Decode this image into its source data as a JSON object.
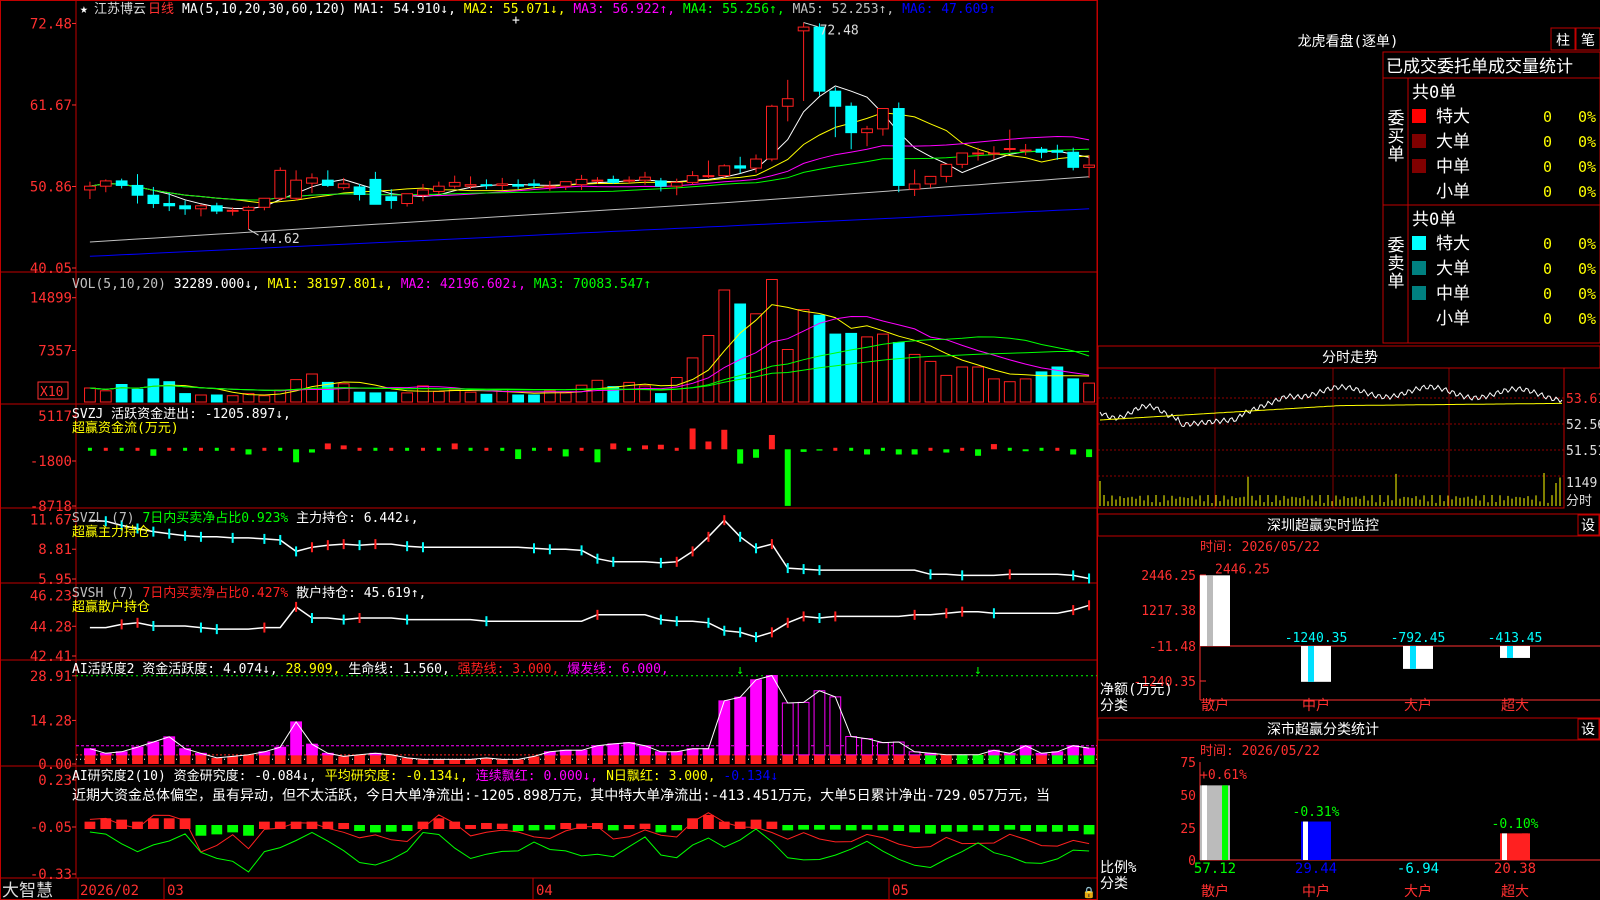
{
  "stock": {
    "name": "江苏博云",
    "period": "日线"
  },
  "colors": {
    "up": "#ff2020",
    "down": "#00ffff",
    "frame": "#c00000",
    "ma1": "#ffffff",
    "ma2": "#ffff00",
    "ma3": "#ff00ff",
    "ma4": "#00ff00",
    "ma5": "#c0c0c0",
    "ma6": "#0000ff"
  },
  "main_legend": [
    {
      "text": "MA(5,10,20,30,60,120)",
      "color": "#ffffff"
    },
    {
      "text": "MA1: 54.910↓,",
      "color": "#ffffff"
    },
    {
      "text": "MA2: 55.071↓,",
      "color": "#ffff00"
    },
    {
      "text": "MA3: 56.922↑,",
      "color": "#ff00ff"
    },
    {
      "text": "MA4: 55.256↑,",
      "color": "#00ff00"
    },
    {
      "text": "MA5: 52.253↑,",
      "color": "#c0c0c0"
    },
    {
      "text": "MA6: 47.609↑",
      "color": "#0000ff"
    }
  ],
  "main_axis": [
    "72.48",
    "61.67",
    "50.86",
    "40.05"
  ],
  "main_annotations": {
    "high": "72.48",
    "low": "44.62"
  },
  "vol_legend": [
    {
      "text": "VOL(5,10,20)",
      "color": "#c0c0c0"
    },
    {
      "text": "32289.000↓,",
      "color": "#ffffff"
    },
    {
      "text": "MA1: 38197.801↓,",
      "color": "#ffff00"
    },
    {
      "text": "MA2: 42196.602↓,",
      "color": "#ff00ff"
    },
    {
      "text": "MA3: 70083.547↑",
      "color": "#00ff00"
    }
  ],
  "vol_axis": [
    "14899",
    "7357"
  ],
  "vol_unit": "X10",
  "svzj_legend": [
    {
      "text": "SVZJ  活跃资金进出: -1205.897↓,",
      "color": "#ffffff"
    }
  ],
  "svzj_sub": "超赢资金流(万元)",
  "svzj_axis": [
    "5117",
    "-1800",
    "-8718"
  ],
  "svzl_legend": [
    {
      "text": "SVZL (7)",
      "color": "#c0c0c0"
    },
    {
      "text": "7日内买卖净占比0.923%",
      "color": "#00ff00"
    },
    {
      "text": "主力持仓: 6.442↓,",
      "color": "#ffffff"
    }
  ],
  "svzl_sub": "超赢主力持仓",
  "svzl_axis": [
    "11.67",
    "8.81",
    "5.95"
  ],
  "svsh_legend": [
    {
      "text": "SVSH (7)",
      "color": "#c0c0c0"
    },
    {
      "text": "7日内买卖净占比0.427%",
      "color": "#ff2020"
    },
    {
      "text": "散户持仓: 45.619↑,",
      "color": "#ffffff"
    }
  ],
  "svsh_sub": "超赢散户持仓",
  "svsh_axis": [
    "46.23",
    "44.28",
    "42.41"
  ],
  "ai1_legend": [
    {
      "text": "AI活跃度2 资金活跃度: 4.074↓,",
      "color": "#ffffff"
    },
    {
      "text": "28.909,",
      "color": "#ffff00"
    },
    {
      "text": "生命线: 1.560,",
      "color": "#ffffff"
    },
    {
      "text": "强势线: 3.000,",
      "color": "#ff2020"
    },
    {
      "text": "爆发线: 6.000,",
      "color": "#ff00ff"
    }
  ],
  "ai1_axis": [
    "28.91",
    "14.28",
    "0.00"
  ],
  "ai2_legend": [
    {
      "text": "AI研究度2(10) 资金研究度: -0.084↓,",
      "color": "#ffffff"
    },
    {
      "text": "平均研究度: -0.134↓,",
      "color": "#ffff00"
    },
    {
      "text": "连续飘红: 0.000↓,",
      "color": "#ff00ff"
    },
    {
      "text": "N日飘红: 3.000,",
      "color": "#ffff00"
    },
    {
      "text": "-0.134↓",
      "color": "#0000ff"
    }
  ],
  "ai2_text": "近期大资金总体偏空，虽有异动，但不太活跃，今日大单净流出:-1205.898万元，其中特大单净流出:-413.451万元，大单5日累计净出-729.057万元，当",
  "ai2_axis": [
    "0.23",
    "-0.05",
    "-0.33"
  ],
  "bottom_bar": {
    "brand": "大智慧",
    "date": "2026/02",
    "months": [
      "03",
      "04",
      "05"
    ]
  },
  "lhb": {
    "title": "龙虎看盘(逐单)",
    "btn1": "柱",
    "btn2": "笔",
    "header": "已成交委托单成交量统计",
    "buy_label": "委买单",
    "sell_label": "委卖单",
    "buy_total": "共0单",
    "sell_total": "共0单",
    "buy_rows": [
      {
        "name": "特大",
        "count": "0",
        "pct": "0%",
        "color": "#ff0000"
      },
      {
        "name": "大单",
        "count": "0",
        "pct": "0%",
        "color": "#800000"
      },
      {
        "name": "中单",
        "count": "0",
        "pct": "0%",
        "color": "#800000"
      },
      {
        "name": "小单",
        "count": "0",
        "pct": "0%",
        "color": "#000000"
      }
    ],
    "sell_rows": [
      {
        "name": "特大",
        "count": "0",
        "pct": "0%",
        "color": "#00ffff"
      },
      {
        "name": "大单",
        "count": "0",
        "pct": "0%",
        "color": "#008080"
      },
      {
        "name": "中单",
        "count": "0",
        "pct": "0%",
        "color": "#008080"
      },
      {
        "name": "小单",
        "count": "0",
        "pct": "0%",
        "color": "#000000"
      }
    ]
  },
  "intraday": {
    "title": "分时走势",
    "axis": [
      "53.61",
      "52.56",
      "51.51"
    ],
    "vol_axis": "1149",
    "unit": "分时"
  },
  "sz_monitor": {
    "title": "深圳超赢实时监控",
    "btn": "设",
    "time": "时间: 2026/05/22",
    "axis": [
      "2446.25",
      "1217.38",
      "-11.48",
      "-1240.35"
    ],
    "ylabel": "净额(万元)",
    "xlabel": "分类",
    "categories": [
      "散户",
      "中户",
      "大户",
      "超大"
    ],
    "bar_labels": [
      "2446.25",
      "-1240.35",
      "-792.45",
      "-413.45"
    ]
  },
  "sz_class": {
    "title": "深市超赢分类统计",
    "btn": "设",
    "time": "时间: 2026/05/22",
    "axis": [
      "75",
      "50",
      "25",
      "0"
    ],
    "ylabel": "比例%",
    "xlabel": "分类",
    "categories": [
      "散户",
      "中户",
      "大户",
      "超大"
    ],
    "top_labels": [
      "+0.61%",
      "-0.31%",
      "",
      "-0.10%"
    ],
    "bottom_labels": [
      "57.12",
      "29.44",
      "-6.94",
      "20.38"
    ]
  },
  "chart_data": [
    {
      "type": "candlestick",
      "title": "江苏博云 日线",
      "x": [
        "2026-02-26",
        "2026-02-27",
        "2026-03-02",
        "2026-03-03",
        "2026-03-04",
        "2026-03-05",
        "2026-03-06",
        "2026-03-09",
        "2026-03-10",
        "2026-03-11",
        "2026-03-12",
        "2026-03-13",
        "2026-03-16",
        "2026-03-17",
        "2026-03-18",
        "2026-03-19",
        "2026-03-20",
        "2026-03-23",
        "2026-03-24",
        "2026-03-25",
        "2026-03-26",
        "2026-03-27",
        "2026-03-30",
        "2026-03-31",
        "2026-04-01",
        "2026-04-02",
        "2026-04-03",
        "2026-04-07",
        "2026-04-08",
        "2026-04-09",
        "2026-04-10",
        "2026-04-13",
        "2026-04-14",
        "2026-04-15",
        "2026-04-16",
        "2026-04-17",
        "2026-04-20",
        "2026-04-21",
        "2026-04-22",
        "2026-04-23",
        "2026-04-24",
        "2026-04-27",
        "2026-04-28",
        "2026-04-29",
        "2026-04-30",
        "2026-05-06",
        "2026-05-07",
        "2026-05-08",
        "2026-05-11",
        "2026-05-12",
        "2026-05-13",
        "2026-05-14",
        "2026-05-15",
        "2026-05-18",
        "2026-05-19",
        "2026-05-20",
        "2026-05-21",
        "2026-05-22",
        "2026-05-25",
        "2026-05-26",
        "2026-05-27",
        "2026-05-28",
        "2026-05-29",
        "2026-06-01"
      ],
      "open": [
        50.4,
        50.9,
        51.6,
        51.0,
        49.7,
        48.6,
        48.3,
        47.9,
        48.3,
        47.6,
        47.7,
        48.1,
        49.3,
        49.3,
        51.3,
        51.7,
        50.7,
        50.8,
        51.8,
        49.5,
        48.6,
        49.7,
        50.2,
        50.9,
        50.9,
        51.1,
        51.0,
        51.1,
        51.2,
        50.9,
        50.9,
        51.1,
        51.7,
        51.8,
        51.7,
        51.7,
        51.6,
        50.9,
        51.4,
        52.3,
        52.3,
        53.6,
        53.3,
        54.5,
        61.5,
        71.5,
        72.0,
        63.5,
        61.5,
        58.0,
        58.5,
        61.2,
        50.5,
        51.2,
        52.2,
        53.8,
        55.3,
        55.3,
        55.9,
        55.7,
        55.8,
        55.6,
        55.4,
        53.4
      ],
      "high": [
        51.5,
        51.8,
        51.9,
        52.5,
        50.8,
        50.0,
        49.0,
        48.5,
        48.7,
        48.1,
        48.3,
        49.2,
        53.4,
        53.0,
        52.6,
        53.0,
        52.0,
        51.2,
        52.8,
        50.5,
        49.9,
        51.2,
        51.5,
        52.3,
        52.2,
        51.8,
        52.0,
        51.8,
        51.8,
        51.6,
        51.5,
        52.4,
        52.1,
        52.3,
        52.2,
        52.8,
        52.0,
        51.9,
        52.9,
        54.3,
        53.8,
        54.8,
        55.1,
        61.7,
        65.0,
        72.6,
        72.5,
        64.0,
        62.0,
        58.9,
        59.5,
        62.0,
        53.1,
        51.8,
        53.3,
        55.0,
        56.0,
        56.2,
        58.4,
        56.5,
        56.1,
        56.4,
        56.0,
        55.0
      ],
      "low": [
        49.2,
        50.1,
        50.6,
        48.6,
        48.0,
        47.6,
        47.1,
        46.9,
        47.2,
        47.0,
        45.2,
        47.7,
        49.0,
        49.0,
        50.0,
        50.8,
        50.4,
        49.0,
        49.3,
        47.9,
        48.2,
        48.9,
        49.8,
        50.6,
        50.5,
        50.5,
        50.4,
        50.5,
        50.6,
        50.3,
        50.4,
        50.4,
        51.2,
        51.2,
        51.2,
        51.1,
        50.2,
        49.7,
        51.1,
        52.0,
        52.0,
        52.6,
        52.7,
        54.2,
        59.5,
        62.2,
        62.9,
        57.4,
        55.8,
        56.2,
        57.6,
        50.1,
        49.6,
        50.7,
        51.4,
        53.3,
        54.3,
        54.5,
        55.4,
        55.0,
        54.6,
        54.4,
        53.0,
        52.0
      ],
      "close": [
        50.9,
        51.6,
        51.0,
        49.7,
        48.6,
        48.3,
        47.9,
        48.3,
        47.6,
        47.7,
        48.1,
        49.3,
        53.0,
        51.7,
        52.0,
        51.0,
        51.2,
        49.8,
        48.5,
        49.0,
        49.9,
        50.4,
        50.9,
        51.4,
        51.1,
        51.0,
        51.2,
        50.9,
        51.0,
        50.9,
        51.5,
        51.8,
        51.7,
        51.4,
        51.7,
        52.1,
        50.9,
        51.4,
        52.3,
        52.3,
        53.6,
        53.3,
        54.5,
        61.5,
        62.5,
        72.0,
        63.5,
        61.5,
        58.0,
        58.5,
        61.2,
        51.0,
        51.2,
        52.2,
        53.8,
        55.3,
        55.3,
        55.3,
        55.9,
        55.7,
        55.4,
        55.4,
        53.4,
        53.7
      ],
      "ma_legend": [
        "MA1",
        "MA2",
        "MA3",
        "MA4",
        "MA5",
        "MA6"
      ],
      "yticks": [
        72.48,
        61.67,
        50.86,
        40.05
      ],
      "ylim": [
        40.05,
        74.0
      ]
    },
    {
      "type": "bar",
      "title": "VOL(5,10,20)",
      "values": [
        2000,
        1600,
        2500,
        1800,
        3300,
        2900,
        1200,
        1000,
        1000,
        900,
        1200,
        900,
        1700,
        3200,
        4000,
        2800,
        2600,
        1400,
        1300,
        1400,
        1300,
        2300,
        1500,
        1700,
        1400,
        1100,
        1800,
        1000,
        1000,
        1600,
        1300,
        2400,
        3100,
        2200,
        2800,
        2300,
        1200,
        3500,
        6300,
        9500,
        16000,
        14000,
        12600,
        17500,
        7500,
        13200,
        12400,
        9700,
        9800,
        9300,
        9700,
        8500,
        6800,
        5800,
        3800,
        5000,
        5000,
        3300,
        2900,
        3300,
        4300,
        5000,
        3300,
        2700
      ],
      "yticks": [
        14899,
        7357
      ],
      "ylim": [
        0,
        18000
      ]
    },
    {
      "type": "bar",
      "title": "SVZJ 活跃资金进出",
      "values": [
        0,
        0,
        0,
        0,
        -1000,
        0,
        0,
        0,
        0,
        0,
        -800,
        0,
        0,
        -2000,
        -500,
        900,
        600,
        0,
        0,
        0,
        0,
        0,
        0,
        900,
        0,
        0,
        0,
        -1500,
        0,
        0,
        -1100,
        0,
        -2000,
        900,
        0,
        600,
        700,
        0,
        3200,
        1200,
        3000,
        -2200,
        -1300,
        2200,
        -8700,
        -400,
        -200,
        0,
        0,
        -800,
        0,
        -800,
        -800,
        0,
        -500,
        0,
        -1000,
        800,
        0,
        -300,
        0,
        0,
        -800,
        -1200
      ],
      "yticks": [
        5117,
        -1800,
        -8718
      ],
      "ylim": [
        -8718,
        5117
      ]
    },
    {
      "type": "line",
      "title": "SVZL 主力持仓",
      "values": [
        11.6,
        11.5,
        11.1,
        10.8,
        10.5,
        10.3,
        10.1,
        10.0,
        10.0,
        9.9,
        9.9,
        9.8,
        9.7,
        8.6,
        9.0,
        9.2,
        9.3,
        9.2,
        9.3,
        9.3,
        9.1,
        9.0,
        9.0,
        9.0,
        9.0,
        9.0,
        9.0,
        9.0,
        8.9,
        8.8,
        8.8,
        8.7,
        7.9,
        7.6,
        7.6,
        7.6,
        7.5,
        7.6,
        8.6,
        10.0,
        11.6,
        10.0,
        8.9,
        9.3,
        7.0,
        6.9,
        6.8,
        6.8,
        6.8,
        6.8,
        6.8,
        6.8,
        6.8,
        6.4,
        6.4,
        6.3,
        6.3,
        6.3,
        6.4,
        6.4,
        6.4,
        6.4,
        6.3,
        6.0
      ],
      "yticks": [
        11.67,
        8.81,
        5.95
      ],
      "ylim": [
        5.95,
        12.0
      ]
    },
    {
      "type": "line",
      "title": "SVSH 散户持仓",
      "values": [
        44.2,
        44.2,
        44.4,
        44.5,
        44.3,
        44.3,
        44.3,
        44.2,
        44.1,
        44.1,
        44.1,
        44.2,
        44.2,
        45.5,
        44.8,
        44.8,
        44.7,
        44.8,
        44.8,
        44.8,
        44.7,
        44.7,
        44.7,
        44.7,
        44.7,
        44.6,
        44.6,
        44.6,
        44.6,
        44.6,
        44.6,
        44.6,
        45.0,
        45.0,
        45.0,
        45.0,
        44.7,
        44.6,
        44.6,
        44.5,
        44.0,
        43.9,
        43.6,
        43.9,
        44.5,
        44.9,
        44.8,
        44.9,
        44.9,
        44.9,
        44.9,
        44.9,
        45.0,
        45.0,
        45.1,
        45.2,
        45.2,
        45.1,
        45.1,
        45.1,
        45.1,
        45.1,
        45.3,
        45.6
      ],
      "yticks": [
        46.23,
        44.28,
        42.41
      ],
      "ylim": [
        42.41,
        46.5
      ]
    },
    {
      "type": "bar",
      "title": "AI活跃度2",
      "values": [
        5.0,
        3.5,
        4.0,
        5.5,
        7.2,
        8.9,
        5.0,
        3.5,
        2.0,
        2.5,
        3.0,
        4.0,
        5.5,
        13.8,
        6.5,
        3.5,
        2.5,
        3.0,
        3.5,
        3.0,
        2.0,
        1.5,
        1.5,
        1.5,
        1.5,
        2.0,
        1.5,
        1.5,
        2.5,
        4.0,
        4.5,
        4.5,
        6.0,
        6.6,
        7.0,
        6.0,
        4.0,
        4.0,
        5.0,
        5.0,
        20.7,
        21.9,
        27.6,
        29.0,
        20.0,
        20.2,
        24.0,
        22.0,
        9.0,
        8.3,
        7.0,
        7.2,
        4.0,
        3.5,
        3.0,
        3.0,
        3.0,
        4.5,
        3.5,
        6.0,
        3.5,
        4.0,
        6.0,
        5.2
      ],
      "lines": {
        "强势线": 3.0,
        "爆发线": 6.0,
        "upper": 28.91
      },
      "yticks": [
        28.91,
        14.28,
        0.0
      ],
      "ylim": [
        0,
        29.5
      ]
    },
    {
      "type": "bar",
      "title": "AI研究度2(10)",
      "values": [
        0.05,
        0.1,
        0.08,
        0.05,
        0.1,
        0.1,
        0.1,
        -0.1,
        -0.08,
        -0.05,
        -0.1,
        0.05,
        0.05,
        0.05,
        0.05,
        0.05,
        0.03,
        -0.03,
        -0.05,
        -0.04,
        -0.03,
        0.05,
        0.1,
        0.05,
        0.0,
        0.03,
        0.02,
        -0.03,
        -0.02,
        -0.01,
        0.03,
        0.02,
        0.03,
        -0.02,
        0.0,
        0.02,
        -0.05,
        -0.02,
        0.1,
        0.15,
        0.05,
        0.05,
        0.08,
        0.05,
        -0.02,
        -0.01,
        -0.01,
        -0.01,
        -0.02,
        -0.01,
        -0.02,
        -0.03,
        -0.05,
        -0.07,
        -0.04,
        -0.04,
        -0.02,
        -0.03,
        -0.01,
        -0.03,
        -0.04,
        -0.04,
        -0.03,
        -0.08
      ],
      "yticks": [
        0.23,
        -0.05,
        -0.33
      ],
      "ylim": [
        -0.33,
        0.23
      ]
    }
  ]
}
